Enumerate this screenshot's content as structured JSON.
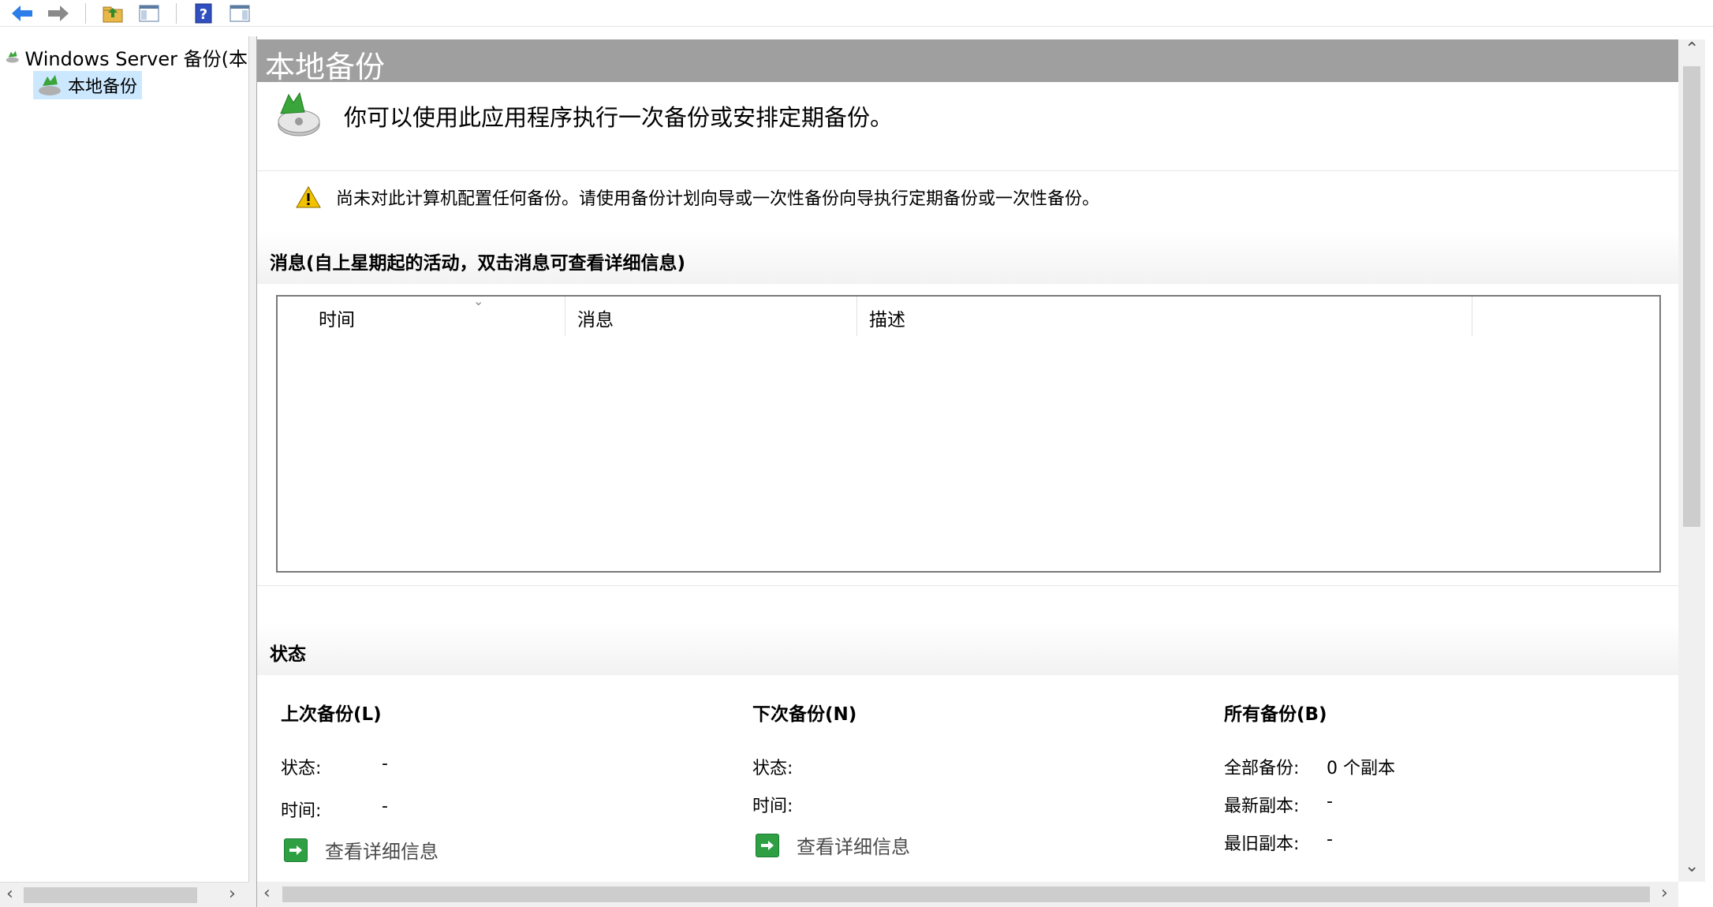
{
  "toolbar": {
    "icons": [
      "back-arrow-icon",
      "forward-arrow-icon",
      "up-folder-icon",
      "show-hide-console-tree-icon",
      "help-icon",
      "show-hide-action-pane-icon"
    ]
  },
  "tree": {
    "root_label": "Windows Server 备份(本",
    "child_label": "本地备份"
  },
  "main": {
    "title": "本地备份",
    "intro": "你可以使用此应用程序执行一次备份或安排定期备份。",
    "warning": "尚未对此计算机配置任何备份。请使用备份计划向导或一次性备份向导执行定期备份或一次性备份。",
    "messages_section": "消息(自上星期起的活动，双击消息可查看详细信息)",
    "columns": [
      "时间",
      "消息",
      "描述"
    ],
    "status_section": "状态",
    "last_backup": {
      "heading": "上次备份(L)",
      "status_label": "状态:",
      "status_value": "-",
      "time_label": "时间:",
      "time_value": "-",
      "details_link": "查看详细信息"
    },
    "next_backup": {
      "heading": "下次备份(N)",
      "status_label": "状态:",
      "time_label": "时间:",
      "details_link": "查看详细信息"
    },
    "all_backups": {
      "heading": "所有备份(B)",
      "total_label": "全部备份:",
      "total_value": "0 个副本",
      "latest_label": "最新副本:",
      "latest_value": "-",
      "oldest_label": "最旧副本:",
      "oldest_value": "-"
    }
  },
  "colors": {
    "title_bar": "#9f9f9f",
    "selection": "#cce8ff",
    "link_button": "#2ea043",
    "warning": "#f2c200"
  }
}
